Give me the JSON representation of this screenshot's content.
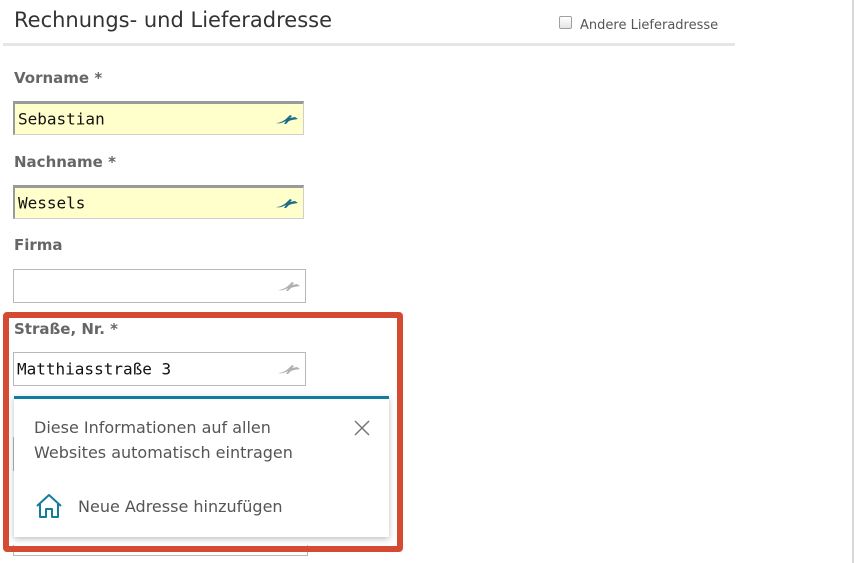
{
  "header": {
    "title": "Rechnungs- und Lieferadresse",
    "alt_delivery_label": "Andere Lieferadresse"
  },
  "form": {
    "fields": [
      {
        "label": "Vorname *",
        "value": "Sebastian",
        "autofilled": true
      },
      {
        "label": "Nachname *",
        "value": "Wessels",
        "autofilled": true
      },
      {
        "label": "Firma",
        "value": "",
        "autofilled": false
      },
      {
        "label": "Straße, Nr. *",
        "value": "Matthiasstraße 3",
        "autofilled": false
      }
    ]
  },
  "autofill_popup": {
    "message": "Diese Informationen auf allen Websites automatisch eintragen",
    "action_label": "Neue Adresse hinzufügen"
  },
  "colors": {
    "highlight": "#d44a33",
    "popup_accent": "#137c9e",
    "autofill_bg": "#ffffcc",
    "icon_active": "#1a6e8a",
    "icon_inactive": "#b0b0b0"
  },
  "icons": {
    "field_icon": "autofill-bird-icon",
    "close": "close-icon",
    "home": "home-icon"
  }
}
